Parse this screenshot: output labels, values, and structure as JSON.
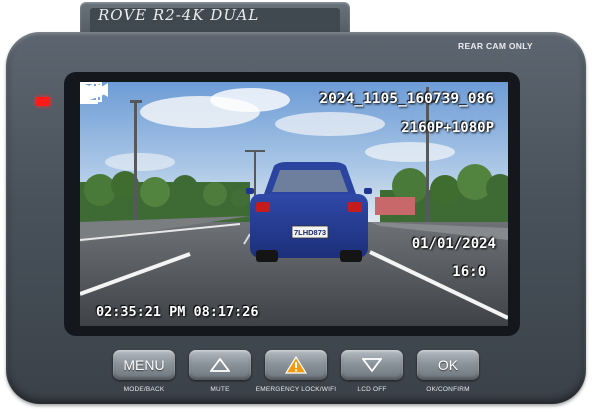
{
  "device": {
    "brand": "ROVE R2-4K DUAL",
    "rear_cam_label": "REAR CAM ONLY",
    "led_color": "#ff1a1a"
  },
  "screen": {
    "filename": "2024_1105_160739_086",
    "resolution": "2160P+1080P",
    "date": "01/01/2024",
    "counter": "16:0",
    "timestamp": "02:35:21 PM 08:17:26",
    "license_plate": "7LHD873",
    "icons": {
      "video_mode": "film-icon",
      "sd_card": "sd-card-icon",
      "rewind": "rewind-icon",
      "fast_forward": "fast-forward-icon",
      "play": "play-icon"
    }
  },
  "buttons": [
    {
      "label": "MENU",
      "caption": "MODE/BACK"
    },
    {
      "label": "",
      "icon": "triangle-up-icon",
      "caption": "MUTE"
    },
    {
      "label": "",
      "icon": "emergency-warning-icon",
      "caption": "EMERGENCY LOCK/WIFI"
    },
    {
      "label": "",
      "icon": "triangle-down-icon",
      "caption": "LCD OFF"
    },
    {
      "label": "OK",
      "caption": "OK/CONFIRM"
    }
  ]
}
